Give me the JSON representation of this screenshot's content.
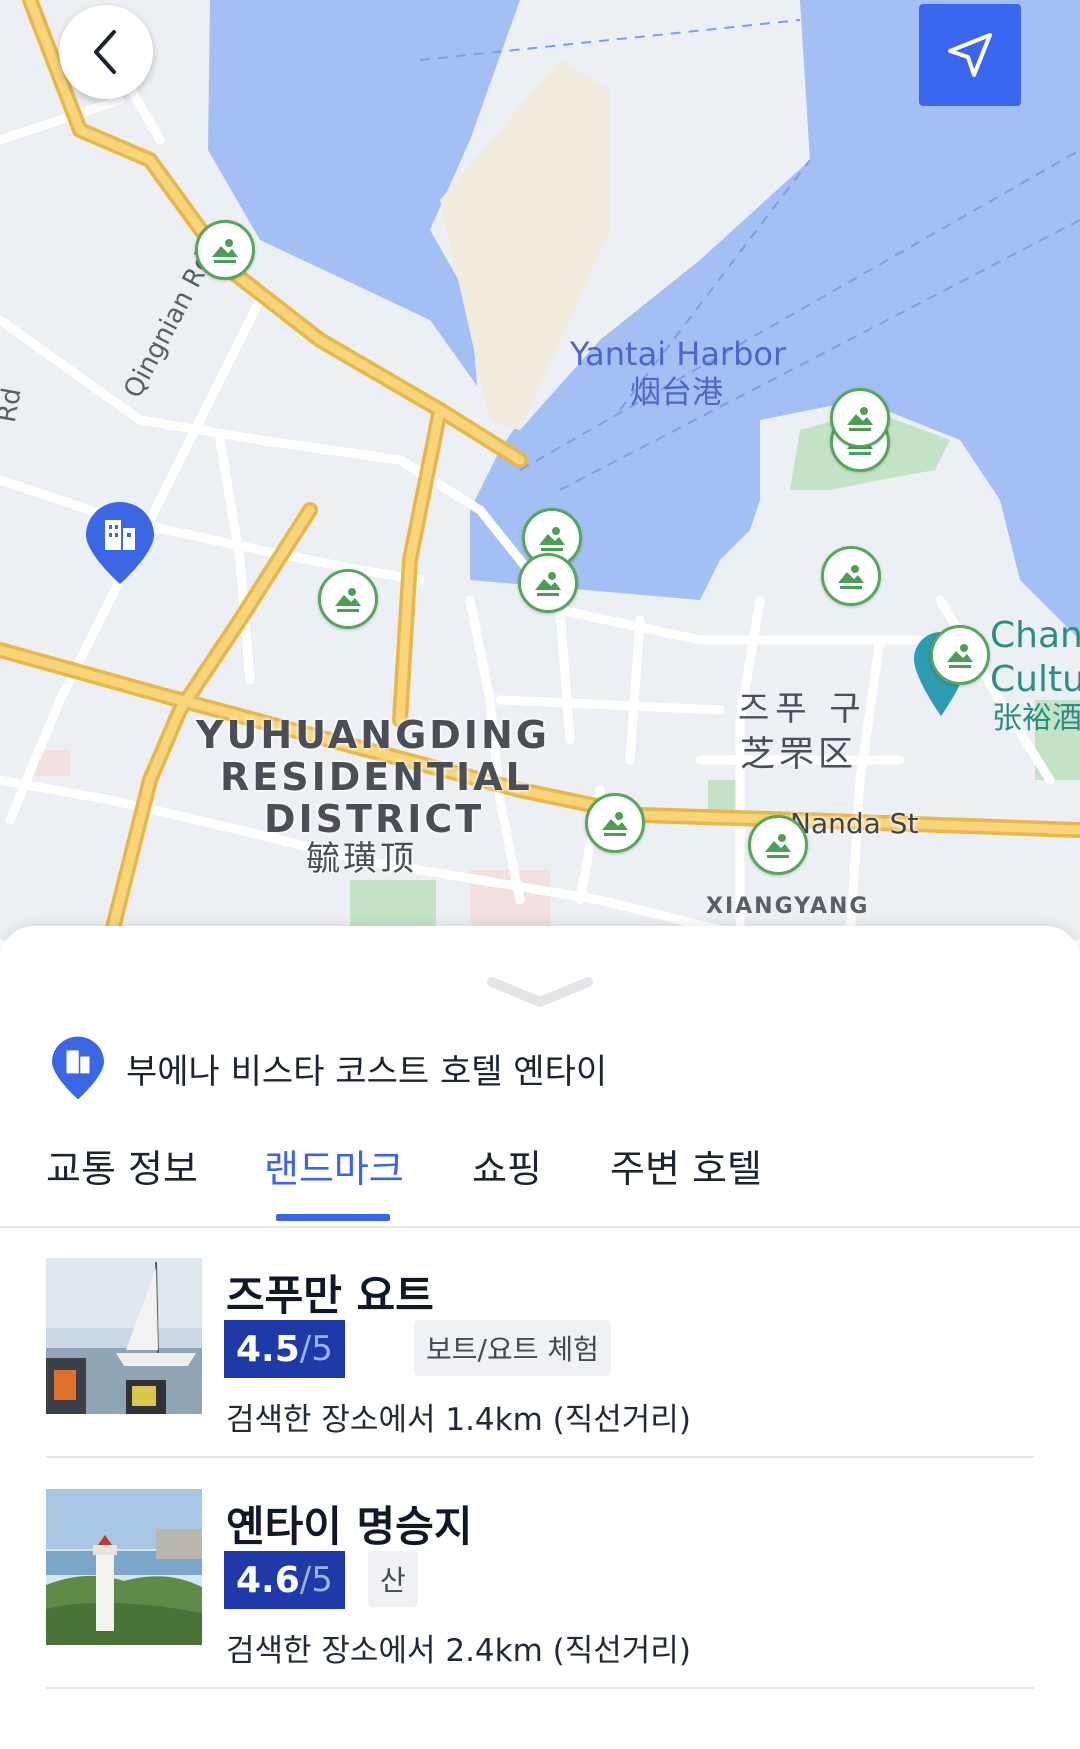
{
  "map": {
    "harbor_label_en": "Yantai Harbor",
    "harbor_label_zh": "烟台港",
    "district_line1": "YUHUANGDING",
    "district_line2": "RESIDENTIAL",
    "district_line3": "DISTRICT",
    "district_zh": "毓璜顶",
    "zhifu_ko": "즈푸 구",
    "zhifu_zh": "芝罘区",
    "street_nanda": "Nanda St",
    "xiangyang": "XIANGYANG",
    "road_qingnian": "Qingnian Rd",
    "road_left": "Rd",
    "poi_line1": "Chan",
    "poi_line2": "Cultu",
    "poi_line3": "张裕酒",
    "colors": {
      "water": "#a4bff3",
      "road": "#f5c55a",
      "park": "#c4e3c6",
      "land": "#eceff3",
      "pin": "#53a85a",
      "hotel_pin": "#3c67e4"
    }
  },
  "controls": {
    "back_icon": "chevron-left-icon",
    "locate_icon": "navigation-arrow-icon",
    "accent": "#3a66f0"
  },
  "sheet": {
    "hotel_name": "부에나 비스타 코스트 호텔 옌타이",
    "tabs": [
      {
        "label": "교통 정보",
        "active": false
      },
      {
        "label": "랜드마크",
        "active": true
      },
      {
        "label": "쇼핑",
        "active": false
      },
      {
        "label": "주변 호텔",
        "active": false
      }
    ],
    "items": [
      {
        "title": "즈푸만 요트",
        "score": "4.5",
        "out_of": "/5",
        "tag": "보트/요트 체험",
        "distance": "검색한 장소에서 1.4km (직선거리)"
      },
      {
        "title": "옌타이 명승지",
        "score": "4.6",
        "out_of": "/5",
        "tag": "산",
        "distance": "검색한 장소에서 2.4km (직선거리)"
      }
    ]
  }
}
